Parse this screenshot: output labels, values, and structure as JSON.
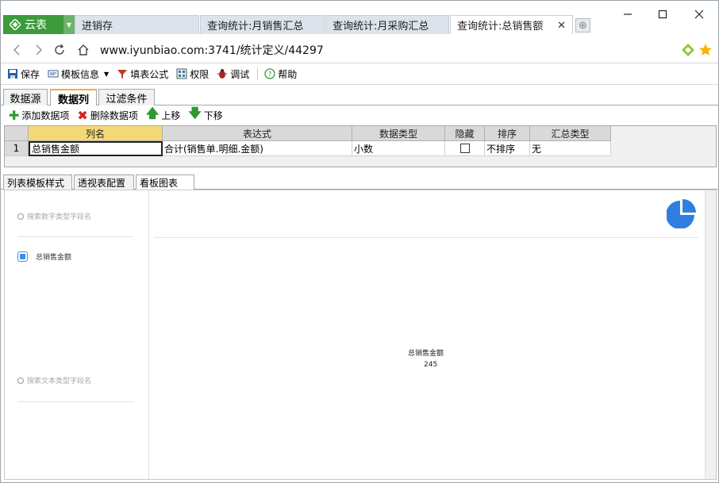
{
  "app": {
    "name": "云表",
    "logo_icon": "cloud-diamond-logo",
    "accent": "#3c9b3c"
  },
  "browser_tabs": [
    {
      "label": "进销存"
    },
    {
      "label": "查询统计:月销售汇总"
    },
    {
      "label": "查询统计:月采购汇总"
    },
    {
      "label": "查询统计:总销售额",
      "active": true
    }
  ],
  "address_bar": {
    "url_host": "www.iyunbiao.com:3741",
    "url_path": "/统计定义/44297"
  },
  "toolbar": {
    "save": "保存",
    "template_info": "模板信息",
    "fill_formula": "填表公式",
    "permission": "权限",
    "debug": "调试",
    "help": "帮助"
  },
  "top_tabs": {
    "datasource": "数据源",
    "datacolumns": "数据列",
    "filter": "过滤条件"
  },
  "sub_toolbar": {
    "add": "添加数据项",
    "delete": "删除数据项",
    "up": "上移",
    "down": "下移"
  },
  "grid": {
    "columns": [
      "列名",
      "表达式",
      "数据类型",
      "隐藏",
      "排序",
      "汇总类型"
    ],
    "rows": [
      {
        "num": "1",
        "name": "总销售金额",
        "expr": "合计(销售单.明细.金额)",
        "dtype": "小数",
        "hidden": false,
        "sort": "不排序",
        "agg": "无"
      }
    ]
  },
  "lower_tabs": {
    "list_style": "列表模板样式",
    "pivot": "透视表配置",
    "dashboard": "看板图表"
  },
  "panel": {
    "search_numeric_placeholder": "搜索数字类型字段名",
    "search_text_placeholder": "搜索文本类型字段名",
    "numeric_fields": [
      {
        "label": "总销售金额",
        "checked": true
      }
    ],
    "kpi": {
      "label": "总销售金额",
      "value": "245"
    },
    "chart_type_icon": "pie-chart-icon"
  }
}
